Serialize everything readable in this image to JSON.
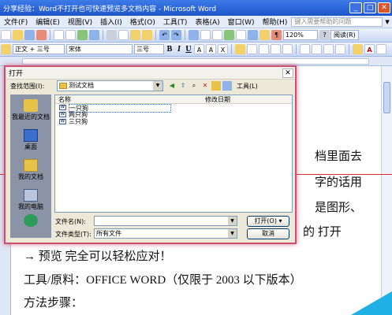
{
  "window": {
    "title": "分享经验：Word不打开也可快速预览多文档内容 - Microsoft Word",
    "buttons": {
      "minimize": "_",
      "maximize": "□",
      "close": "✕"
    }
  },
  "menu": {
    "items": [
      "文件(F)",
      "编辑(E)",
      "视图(V)",
      "插入(I)",
      "格式(O)",
      "工具(T)",
      "表格(A)",
      "窗口(W)",
      "帮助(H)"
    ],
    "ask_placeholder": "键入需要帮助的问题"
  },
  "toolbar": {
    "zoom": "120%",
    "read": "阅读(R)",
    "style": "正文 + 三号",
    "font": "宋体",
    "size": "三号",
    "bold": "B",
    "italic": "I",
    "underline": "U"
  },
  "document": {
    "lines": [
      "档里面去",
      "字的话用",
      "是图形、",
      "的  打开",
      "→ 预览  完全可以轻松应对！",
      "工具/原料：OFFICE WORD（仅限于 2003 以下版本）",
      "方法步骤："
    ]
  },
  "dialog": {
    "title": "打开",
    "close": "✕",
    "lookin_label": "查找范围(I):",
    "lookin_value": "测试文档",
    "tools_label": "工具(L)",
    "places": [
      "我最近的文档",
      "桌面",
      "我的文档",
      "我的电脑",
      ""
    ],
    "columns": {
      "name": "名称",
      "date": "修改日期"
    },
    "files": [
      "一只狗",
      "两只狗",
      "三只狗"
    ],
    "filename_label": "文件名(N):",
    "filename_value": "",
    "filetype_label": "文件类型(T):",
    "filetype_value": "所有文件",
    "open_button": "打开(O)",
    "cancel_button": "取消"
  }
}
